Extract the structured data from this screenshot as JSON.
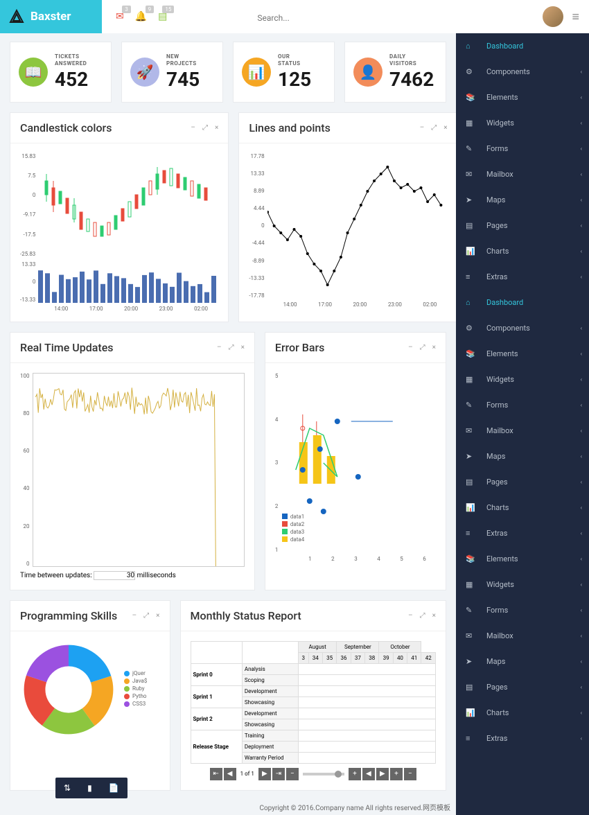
{
  "brand": "Baxster",
  "topbar": {
    "badges": {
      "mail": "3",
      "bell": "9",
      "note": "15"
    },
    "search_placeholder": "Search..."
  },
  "stats": [
    {
      "label_l1": "TICKETS",
      "label_l2": "ANSWERED",
      "value": "452",
      "color": "#8dc63f",
      "icon": "📖"
    },
    {
      "label_l1": "NEW",
      "label_l2": "PROJECTS",
      "value": "745",
      "color": "#b1b8e8",
      "icon": "🚀"
    },
    {
      "label_l1": "OUR",
      "label_l2": "STATUS",
      "value": "125",
      "color": "#f5a623",
      "icon": "📊"
    },
    {
      "label_l1": "DAILY",
      "label_l2": "VISITORS",
      "value": "7462",
      "color": "#f28c5a",
      "icon": "👤"
    }
  ],
  "panels": {
    "candlestick": {
      "title": "Candlestick colors"
    },
    "lines": {
      "title": "Lines and points"
    },
    "realtime": {
      "title": "Real Time Updates",
      "update_label_pre": "Time between updates:",
      "update_value": "30",
      "update_label_post": "milliseconds"
    },
    "errorbars": {
      "title": "Error Bars",
      "legend": [
        "data1",
        "data2",
        "data3",
        "data4"
      ]
    },
    "skills": {
      "title": "Programming Skills",
      "legend": [
        {
          "label": "jQuer",
          "color": "#1da1f2"
        },
        {
          "label": "Java$",
          "color": "#f5a623"
        },
        {
          "label": "Ruby",
          "color": "#8dc63f"
        },
        {
          "label": "Pytho",
          "color": "#e94b3c"
        },
        {
          "label": "CSS3",
          "color": "#9b51e0"
        }
      ]
    },
    "monthly": {
      "title": "Monthly Status Report",
      "months": [
        "August",
        "September",
        "October"
      ],
      "days": [
        "3",
        "34",
        "35",
        "36",
        "37",
        "38",
        "39",
        "40",
        "41",
        "42"
      ],
      "rows": [
        {
          "sprint": "Sprint 0",
          "tasks": [
            "Analysis",
            "Scoping"
          ]
        },
        {
          "sprint": "Sprint 1",
          "tasks": [
            "Development",
            "Showcasing"
          ]
        },
        {
          "sprint": "Sprint 2",
          "tasks": [
            "Development",
            "Showcasing"
          ]
        },
        {
          "sprint": "Release Stage",
          "tasks": [
            "Training",
            "Deployment",
            "Warranty Period"
          ]
        }
      ],
      "pager": "1 of 1"
    }
  },
  "nav": [
    {
      "label": "Dashboard",
      "icon": "⌂",
      "active": true,
      "chev": false
    },
    {
      "label": "Components",
      "icon": "⚙",
      "chev": true
    },
    {
      "label": "Elements",
      "icon": "📚",
      "chev": true
    },
    {
      "label": "Widgets",
      "icon": "▦",
      "chev": true
    },
    {
      "label": "Forms",
      "icon": "✎",
      "chev": true
    },
    {
      "label": "Mailbox",
      "icon": "✉",
      "chev": true
    },
    {
      "label": "Maps",
      "icon": "➤",
      "chev": true
    },
    {
      "label": "Pages",
      "icon": "▤",
      "chev": true
    },
    {
      "label": "Charts",
      "icon": "📊",
      "chev": true
    },
    {
      "label": "Extras",
      "icon": "≡",
      "chev": true
    },
    {
      "label": "Dashboard",
      "icon": "⌂",
      "active": true,
      "chev": false
    },
    {
      "label": "Components",
      "icon": "⚙",
      "chev": true
    },
    {
      "label": "Elements",
      "icon": "📚",
      "chev": true
    },
    {
      "label": "Widgets",
      "icon": "▦",
      "chev": true
    },
    {
      "label": "Forms",
      "icon": "✎",
      "chev": true
    },
    {
      "label": "Mailbox",
      "icon": "✉",
      "chev": true
    },
    {
      "label": "Maps",
      "icon": "➤",
      "chev": true
    },
    {
      "label": "Pages",
      "icon": "▤",
      "chev": true
    },
    {
      "label": "Charts",
      "icon": "📊",
      "chev": true
    },
    {
      "label": "Extras",
      "icon": "≡",
      "chev": true
    },
    {
      "label": "Elements",
      "icon": "📚",
      "chev": true
    },
    {
      "label": "Widgets",
      "icon": "▦",
      "chev": true
    },
    {
      "label": "Forms",
      "icon": "✎",
      "chev": true
    },
    {
      "label": "Mailbox",
      "icon": "✉",
      "chev": true
    },
    {
      "label": "Maps",
      "icon": "➤",
      "chev": true
    },
    {
      "label": "Pages",
      "icon": "▤",
      "chev": true
    },
    {
      "label": "Charts",
      "icon": "📊",
      "chev": true
    },
    {
      "label": "Extras",
      "icon": "≡",
      "chev": true
    }
  ],
  "footer": {
    "copyright": "Copyright © 2016.Company name All rights reserved.网页模板"
  },
  "chart_data": [
    {
      "id": "candlestick",
      "type": "bar",
      "title": "Candlestick colors",
      "yticks_top": [
        15.83,
        7.5,
        0.0,
        -9.17,
        -17.5,
        -25.83
      ],
      "yticks_bottom": [
        13.33,
        0.0,
        -13.33
      ],
      "xticks": [
        "14:00",
        "17:00",
        "20:00",
        "23:00",
        "02:00"
      ]
    },
    {
      "id": "lines",
      "type": "line",
      "title": "Lines and points",
      "yticks": [
        17.78,
        13.33,
        8.89,
        4.44,
        0.0,
        -4.44,
        -8.89,
        -13.33,
        -17.78
      ],
      "xticks": [
        "14:00",
        "17:00",
        "20:00",
        "23:00",
        "02:00"
      ],
      "values": [
        4,
        0,
        -2,
        -4,
        -1,
        -3,
        -8,
        -11,
        -13,
        -17,
        -13,
        -9,
        -2,
        2,
        6,
        10,
        13,
        15,
        17,
        13,
        11,
        12,
        10,
        11,
        7,
        9,
        6
      ]
    },
    {
      "id": "realtime",
      "type": "line",
      "title": "Real Time Updates",
      "ylim": [
        0,
        100
      ],
      "yticks": [
        0,
        20,
        40,
        60,
        80,
        100
      ]
    },
    {
      "id": "errorbars",
      "type": "scatter",
      "title": "Error Bars",
      "xticks": [
        1.0,
        2.0,
        3.0,
        4.0,
        5.0,
        6.0
      ],
      "yticks": [
        1,
        2,
        3,
        4,
        5
      ],
      "series": [
        {
          "name": "data1"
        },
        {
          "name": "data2"
        },
        {
          "name": "data3"
        },
        {
          "name": "data4"
        }
      ]
    },
    {
      "id": "skills",
      "type": "pie",
      "title": "Programming Skills",
      "slices": [
        {
          "label": "jQuery",
          "value": 20
        },
        {
          "label": "JavaScript",
          "value": 20
        },
        {
          "label": "Ruby",
          "value": 20
        },
        {
          "label": "Python",
          "value": 20
        },
        {
          "label": "CSS3",
          "value": 20
        }
      ]
    },
    {
      "id": "monthly",
      "type": "table",
      "title": "Monthly Status Report"
    }
  ]
}
